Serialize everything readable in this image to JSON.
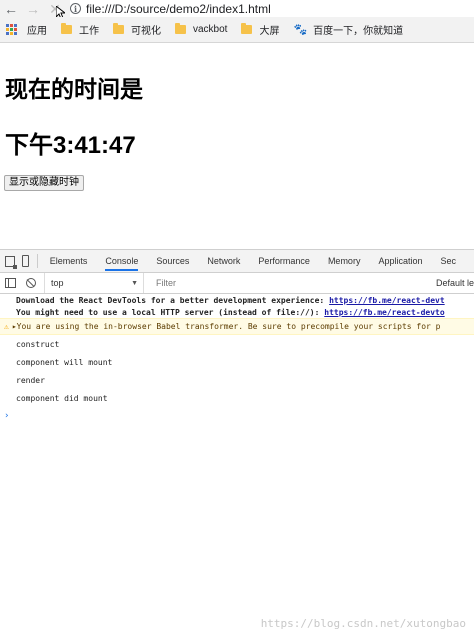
{
  "browser": {
    "url": "file:///D:/source/demo2/index1.html"
  },
  "bookmarks": [
    {
      "label": "应用",
      "icon": "apps-grid-icon"
    },
    {
      "label": "工作",
      "icon": "folder-icon"
    },
    {
      "label": "可视化",
      "icon": "folder-icon"
    },
    {
      "label": "vackbot",
      "icon": "folder-icon"
    },
    {
      "label": "大屏",
      "icon": "folder-icon"
    },
    {
      "label": "百度一下，你就知道",
      "icon": "paw-icon"
    }
  ],
  "page": {
    "heading": "现在的时间是",
    "time": "下午3:41:47",
    "toggle_button": "显示或隐藏时钟"
  },
  "devtools": {
    "tabs": [
      "Elements",
      "Console",
      "Sources",
      "Network",
      "Performance",
      "Memory",
      "Application",
      "Sec"
    ],
    "active_tab": "Console",
    "context": "top",
    "filter_placeholder": "Filter",
    "levels": "Default le",
    "messages": {
      "info1_text": "Download the React DevTools for a better development experience: ",
      "info1_link": "https://fb.me/react-devt",
      "info2_text": "You might need to use a local HTTP server (instead of file://): ",
      "info2_link": "https://fb.me/react-devto",
      "warning": "You are using the in-browser Babel transformer. Be sure to precompile your scripts for p",
      "logs": [
        "construct",
        "component will mount",
        "render",
        "component did mount"
      ]
    },
    "prompt": "›"
  },
  "watermark": "https://blog.csdn.net/xutongbao",
  "colors": {
    "accent": "#1a73e8",
    "folder": "#f6c24a",
    "warning_bg": "#fffbe5"
  }
}
